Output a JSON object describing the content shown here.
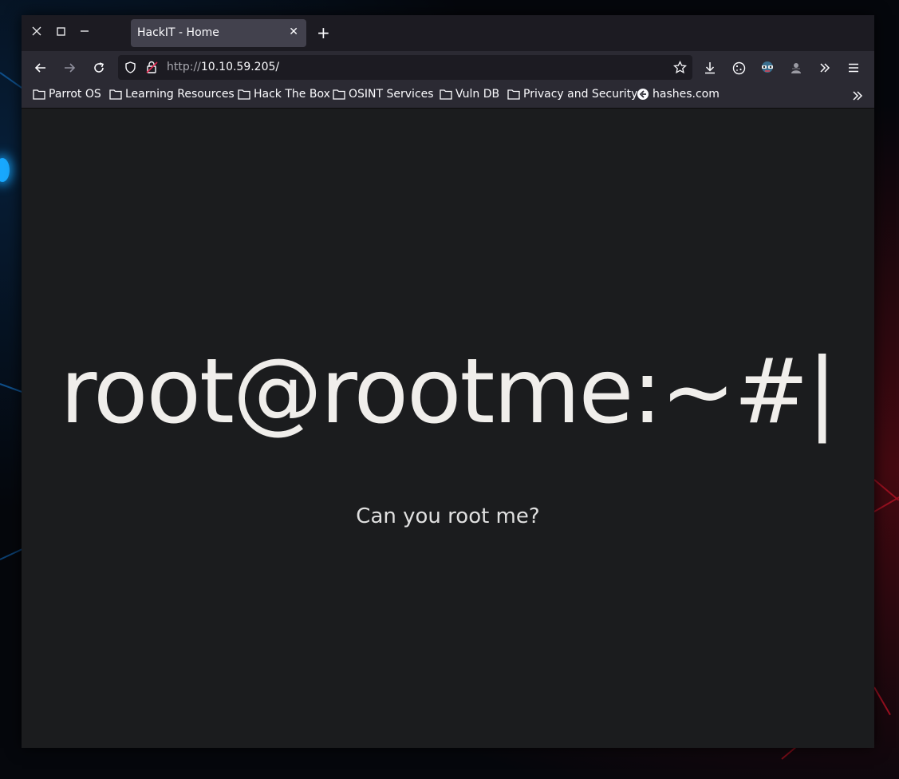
{
  "browser": {
    "tab": {
      "title": "HackIT - Home",
      "close_glyph": "✕"
    },
    "new_tab_glyph": "+",
    "window_controls": [
      "close-icon",
      "maximize-icon",
      "minimize-icon"
    ],
    "address": {
      "protocol": "http://",
      "host": "10.10.59.205/"
    },
    "toolbar_icons": [
      "bookmark-star-icon",
      "download-icon",
      "cookie-icon",
      "extension-icon",
      "puzzle-icon",
      "overflow-chevron-icon",
      "menu-icon"
    ],
    "bookmarks": [
      {
        "label": "Parrot OS",
        "icon": "folder-icon"
      },
      {
        "label": "Learning Resources",
        "icon": "folder-icon"
      },
      {
        "label": "Hack The Box",
        "icon": "folder-icon"
      },
      {
        "label": "OSINT Services",
        "icon": "folder-icon"
      },
      {
        "label": "Vuln DB",
        "icon": "folder-icon"
      },
      {
        "label": "Privacy and Security",
        "icon": "folder-icon"
      },
      {
        "label": "hashes.com",
        "icon": "site-icon"
      }
    ]
  },
  "page": {
    "headline": "root@rootme:~#|",
    "subline": "Can you root me?"
  },
  "colors": {
    "page_background": "#1b1c1e",
    "text": "#f0eeeb",
    "chrome_dark": "#1c1b22",
    "chrome_mid": "#2b2a33",
    "tab_active": "#42414d"
  }
}
